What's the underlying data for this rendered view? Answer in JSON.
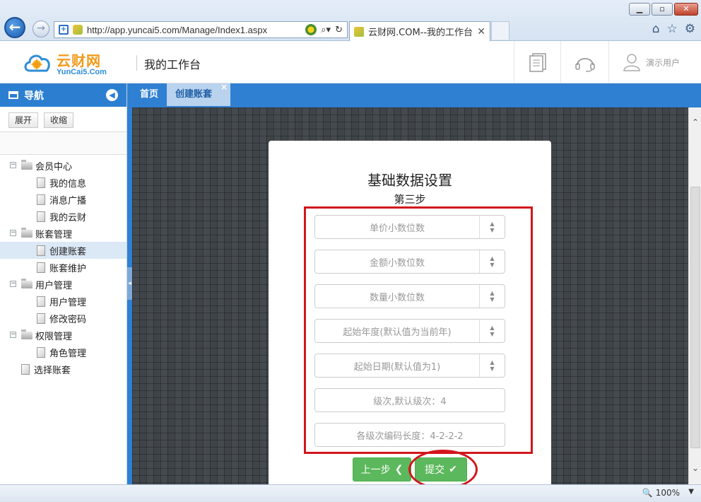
{
  "browser": {
    "url": "http://app.yuncai5.com/Manage/Index1.aspx",
    "tab_title": "云财网.COM--我的工作台",
    "zoom": "100%"
  },
  "header": {
    "logo_cn": "云财网",
    "logo_en": "YunCai5.Com",
    "title": "我的工作台",
    "user_name": "演示用户"
  },
  "sidebar": {
    "title": "导航",
    "expand_label": "展开",
    "collapse_label": "收缩",
    "tree": [
      {
        "label": "会员中心",
        "children": [
          "我的信息",
          "消息广播",
          "我的云财"
        ]
      },
      {
        "label": "账套管理",
        "children": [
          "创建账套",
          "账套维护"
        ]
      },
      {
        "label": "用户管理",
        "children": [
          "用户管理",
          "修改密码"
        ]
      },
      {
        "label": "权限管理",
        "children": [
          "角色管理"
        ]
      },
      {
        "label": "选择账套",
        "children": []
      }
    ]
  },
  "tabs": {
    "home": "首页",
    "create": "创建账套",
    "close": "×"
  },
  "form": {
    "title": "基础数据设置",
    "step": "第三步",
    "fields": [
      "单价小数位数",
      "金额小数位数",
      "数量小数位数",
      "起始年度(默认值为当前年)",
      "起始日期(默认值为1)",
      "级次,默认级次：4",
      "各级次编码长度：4-2-2-2"
    ],
    "prev_label": "上一步",
    "submit_label": "提交"
  },
  "colors": {
    "primary_blue": "#2f80d2",
    "success_green": "#5cb85c",
    "highlight_red": "#d2161c",
    "logo_orange": "#f19a1a"
  }
}
